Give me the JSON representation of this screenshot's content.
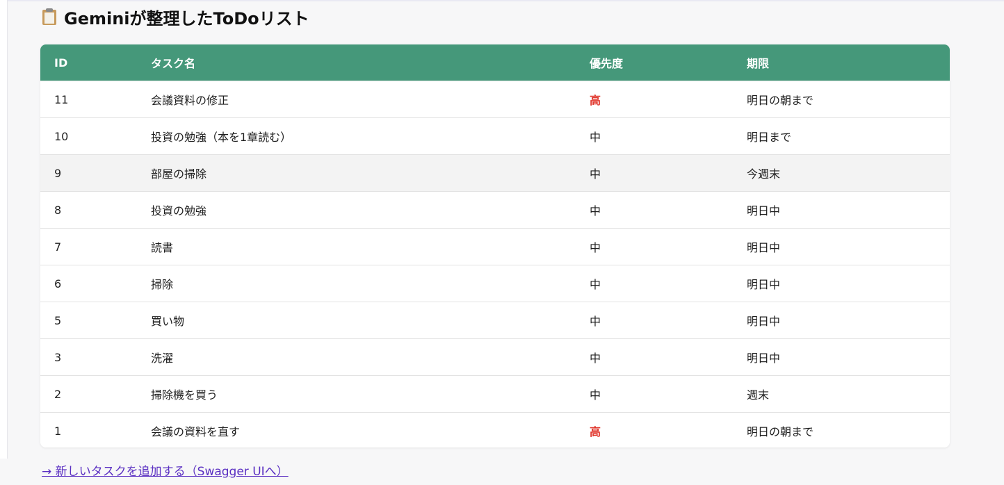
{
  "header": {
    "icon": "clipboard-icon",
    "title": "Geminiが整理したToDoリスト"
  },
  "table": {
    "columns": [
      "ID",
      "タスク名",
      "優先度",
      "期限"
    ],
    "rows": [
      {
        "id": "11",
        "name": "会議資料の修正",
        "priority": "高",
        "due": "明日の朝まで"
      },
      {
        "id": "10",
        "name": "投資の勉強（本を1章読む）",
        "priority": "中",
        "due": "明日まで"
      },
      {
        "id": "9",
        "name": "部屋の掃除",
        "priority": "中",
        "due": "今週末"
      },
      {
        "id": "8",
        "name": "投資の勉強",
        "priority": "中",
        "due": "明日中"
      },
      {
        "id": "7",
        "name": "読書",
        "priority": "中",
        "due": "明日中"
      },
      {
        "id": "6",
        "name": "掃除",
        "priority": "中",
        "due": "明日中"
      },
      {
        "id": "5",
        "name": "買い物",
        "priority": "中",
        "due": "明日中"
      },
      {
        "id": "3",
        "name": "洗濯",
        "priority": "中",
        "due": "明日中"
      },
      {
        "id": "2",
        "name": "掃除機を買う",
        "priority": "中",
        "due": "週末"
      },
      {
        "id": "1",
        "name": "会議の資料を直す",
        "priority": "高",
        "due": "明日の朝まで"
      }
    ]
  },
  "footer": {
    "add_link": "→ 新しいタスクを追加する（Swagger UIへ）"
  },
  "colors": {
    "header_bg": "#45987a",
    "high_priority": "#e0362c",
    "link": "#5a2fc2"
  }
}
